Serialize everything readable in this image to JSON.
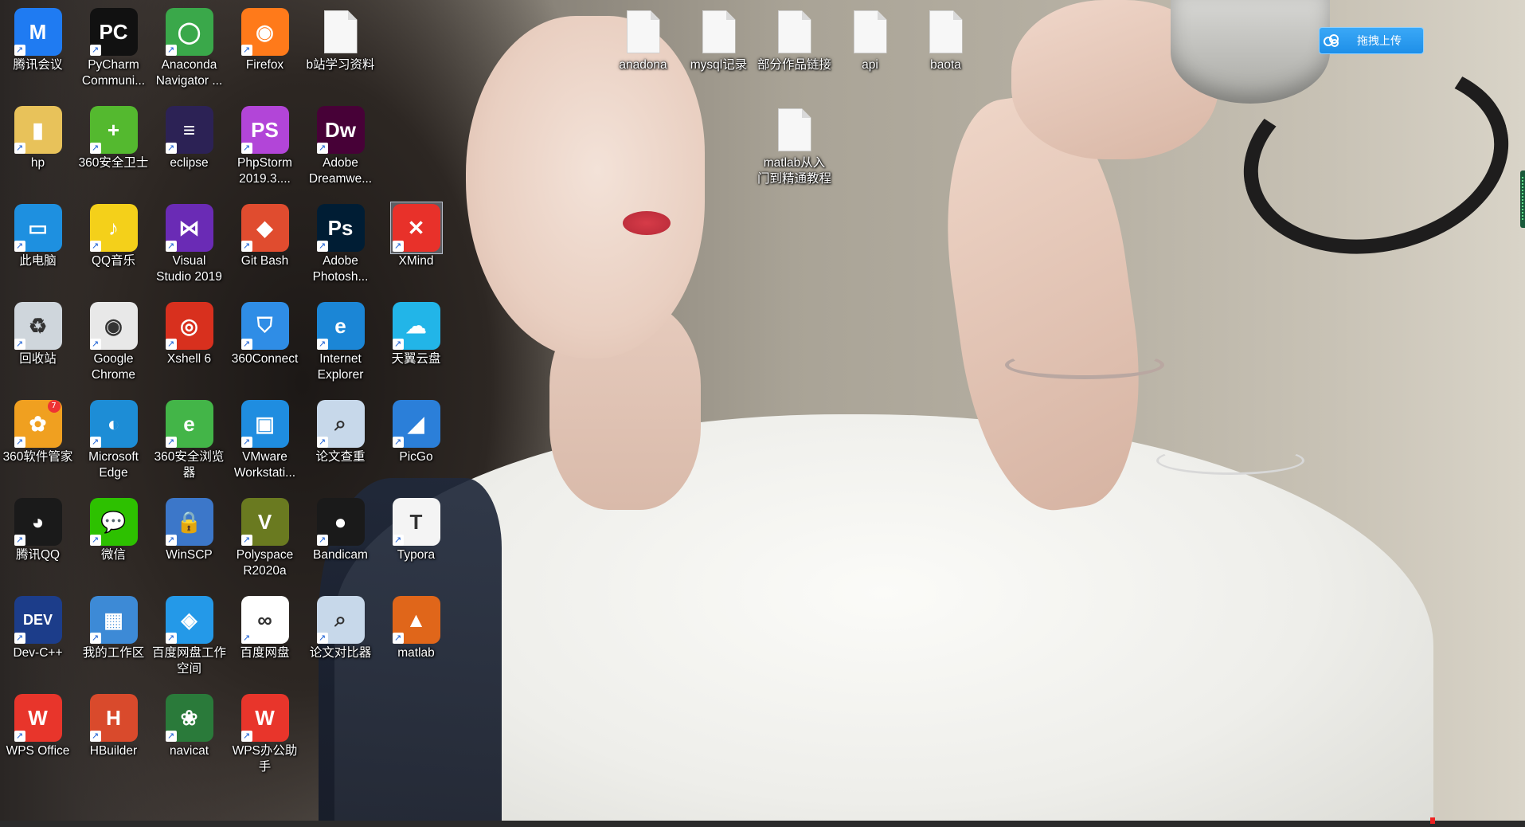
{
  "desktop": {
    "icons": [
      {
        "label": "腾讯会议",
        "icon": "tencent-meeting-icon",
        "glyph": "M",
        "bg": "#1f7bf2"
      },
      {
        "label": "PyCharm\nCommuni...",
        "icon": "pycharm-icon",
        "glyph": "PC",
        "bg": "#111111"
      },
      {
        "label": "Anaconda\nNavigator ...",
        "icon": "anaconda-icon",
        "glyph": "◯",
        "bg": "#3aa84a"
      },
      {
        "label": "Firefox",
        "icon": "firefox-icon",
        "glyph": "◉",
        "bg": "#ff7a1a"
      },
      {
        "label": "b站学习资料",
        "icon": "file-icon",
        "glyph": "",
        "bg": ""
      },
      {
        "label": "hp",
        "icon": "folder-user-icon",
        "glyph": "▮",
        "bg": "#e8c25a"
      },
      {
        "label": "360安全卫士",
        "icon": "360-safe-icon",
        "glyph": "+",
        "bg": "#54b92f"
      },
      {
        "label": "eclipse",
        "icon": "eclipse-icon",
        "glyph": "≡",
        "bg": "#2c2255"
      },
      {
        "label": "PhpStorm\n2019.3....",
        "icon": "phpstorm-icon",
        "glyph": "PS",
        "bg": "#b245d8"
      },
      {
        "label": "Adobe\nDreamwe...",
        "icon": "dreamweaver-icon",
        "glyph": "Dw",
        "bg": "#470137"
      },
      {
        "label": "此电脑",
        "icon": "this-pc-icon",
        "glyph": "▭",
        "bg": "#1e90e0"
      },
      {
        "label": "QQ音乐",
        "icon": "qq-music-icon",
        "glyph": "♪",
        "bg": "#f4d01a"
      },
      {
        "label": "Visual\nStudio 2019",
        "icon": "visual-studio-icon",
        "glyph": "⋈",
        "bg": "#6a2bb5"
      },
      {
        "label": "Git Bash",
        "icon": "git-bash-icon",
        "glyph": "◆",
        "bg": "#e04c2f"
      },
      {
        "label": "Adobe\nPhotosh...",
        "icon": "photoshop-icon",
        "glyph": "Ps",
        "bg": "#001d34"
      },
      {
        "label": "XMind",
        "icon": "xmind-icon",
        "glyph": "✕",
        "bg": "#e8312a"
      },
      {
        "label": "回收站",
        "icon": "recycle-bin-icon",
        "glyph": "♻",
        "bg": "#cfd6dc"
      },
      {
        "label": "Google\nChrome",
        "icon": "chrome-icon",
        "glyph": "◉",
        "bg": "#e8e8e8"
      },
      {
        "label": "Xshell 6",
        "icon": "xshell-icon",
        "glyph": "◎",
        "bg": "#d8301e"
      },
      {
        "label": "360Connect",
        "icon": "360connect-icon",
        "glyph": "⛉",
        "bg": "#2f8de6"
      },
      {
        "label": "Internet\nExplorer",
        "icon": "internet-explorer-icon",
        "glyph": "e",
        "bg": "#1b86d6"
      },
      {
        "label": "天翼云盘",
        "icon": "tianyi-cloud-icon",
        "glyph": "☁",
        "bg": "#22b5e8"
      },
      {
        "label": "360软件管家",
        "icon": "360-software-manager-icon",
        "glyph": "✿",
        "bg": "#f0a020"
      },
      {
        "label": "Microsoft\nEdge",
        "icon": "edge-icon",
        "glyph": "◐",
        "bg": "#1d8dd6"
      },
      {
        "label": "360安全浏览\n器",
        "icon": "360-browser-icon",
        "glyph": "e",
        "bg": "#43b548"
      },
      {
        "label": "VMware\nWorkstati...",
        "icon": "vmware-icon",
        "glyph": "▣",
        "bg": "#1f8de0"
      },
      {
        "label": "论文查重",
        "icon": "magnifier-icon",
        "glyph": "⌕",
        "bg": "#c7d8ea"
      },
      {
        "label": "PicGo",
        "icon": "picgo-icon",
        "glyph": "◢",
        "bg": "#2b7fd9"
      },
      {
        "label": "腾讯QQ",
        "icon": "qq-penguin-icon",
        "glyph": "◕",
        "bg": "#1a1a1a"
      },
      {
        "label": "微信",
        "icon": "wechat-icon",
        "glyph": "💬",
        "bg": "#2dc100"
      },
      {
        "label": "WinSCP",
        "icon": "winscp-icon",
        "glyph": "🔒",
        "bg": "#3c77c9"
      },
      {
        "label": "Polyspace\nR2020a",
        "icon": "polyspace-icon",
        "glyph": "V",
        "bg": "#6a7a20"
      },
      {
        "label": "Bandicam",
        "icon": "bandicam-icon",
        "glyph": "●",
        "bg": "#1a1a1a"
      },
      {
        "label": "Typora",
        "icon": "typora-icon",
        "glyph": "T",
        "bg": "#f4f4f4"
      },
      {
        "label": "Dev-C++",
        "icon": "dev-cpp-icon",
        "glyph": "DEV",
        "bg": "#1c3d8a"
      },
      {
        "label": "我的工作区",
        "icon": "workspace-icon",
        "glyph": "▦",
        "bg": "#3d8ad6"
      },
      {
        "label": "百度网盘工作\n空间",
        "icon": "baidu-workspace-icon",
        "glyph": "◈",
        "bg": "#2499e8"
      },
      {
        "label": "百度网盘",
        "icon": "baidu-netdisk-icon",
        "glyph": "∞",
        "bg": "#ffffff"
      },
      {
        "label": "论文对比器",
        "icon": "magnifier-icon",
        "glyph": "⌕",
        "bg": "#c7d8ea"
      },
      {
        "label": "matlab",
        "icon": "matlab-icon",
        "glyph": "▲",
        "bg": "#e0661a"
      },
      {
        "label": "WPS Office",
        "icon": "wps-office-icon",
        "glyph": "W",
        "bg": "#e8352b"
      },
      {
        "label": "HBuilder",
        "icon": "hbuilder-icon",
        "glyph": "H",
        "bg": "#d94a2c"
      },
      {
        "label": "navicat",
        "icon": "navicat-icon",
        "glyph": "❀",
        "bg": "#2a7a3a"
      },
      {
        "label": "WPS办公助\n手",
        "icon": "wps-assistant-icon",
        "glyph": "W",
        "bg": "#e8352b"
      },
      {
        "label": "anadona",
        "icon": "file-icon",
        "glyph": "",
        "bg": ""
      },
      {
        "label": "mysql记录",
        "icon": "file-icon",
        "glyph": "",
        "bg": ""
      },
      {
        "label": "部分作品链接",
        "icon": "file-icon",
        "glyph": "",
        "bg": ""
      },
      {
        "label": "api",
        "icon": "file-icon",
        "glyph": "",
        "bg": ""
      },
      {
        "label": "baota",
        "icon": "file-icon",
        "glyph": "",
        "bg": ""
      },
      {
        "label": "matlab从入\n门到精通教程",
        "icon": "file-icon",
        "glyph": "",
        "bg": ""
      }
    ]
  },
  "upload_button": {
    "label": "拖拽上传",
    "icon": "baidu-cloud-icon"
  },
  "badges": {
    "360_software_manager": "7"
  }
}
